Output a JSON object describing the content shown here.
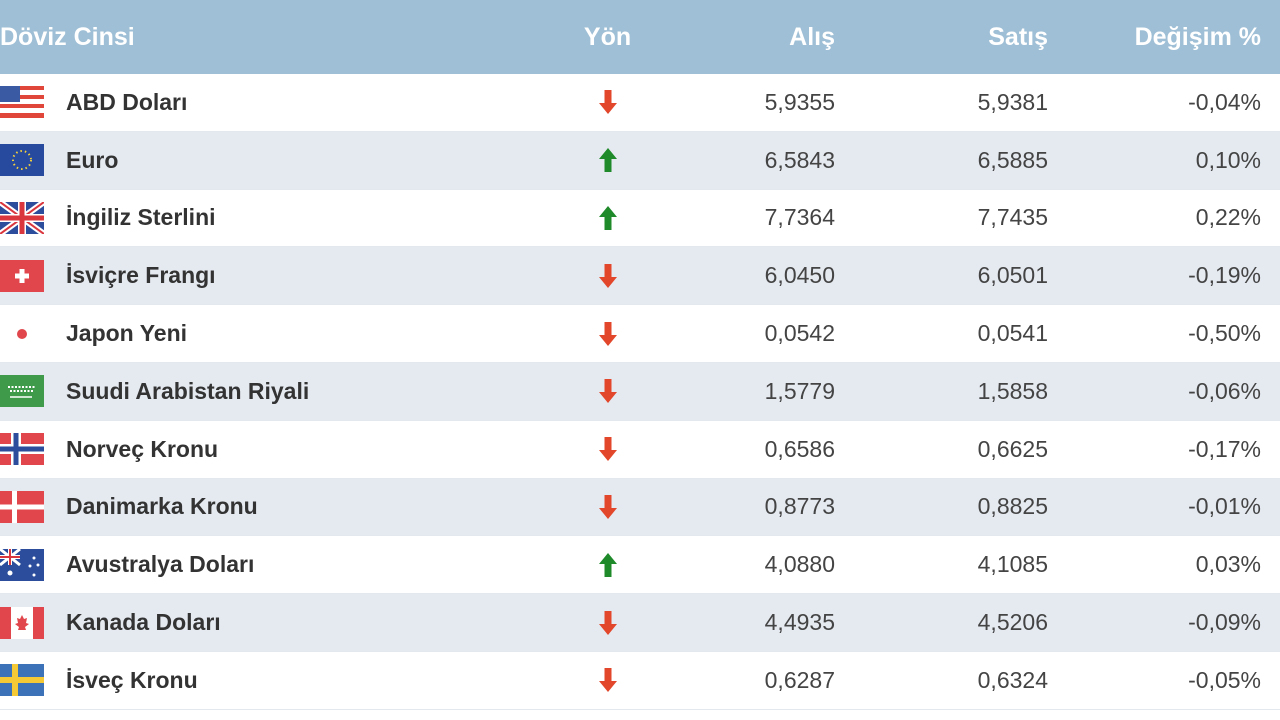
{
  "header": {
    "currency": "Döviz Cinsi",
    "direction": "Yön",
    "buy": "Alış",
    "sell": "Satış",
    "change": "Değişim %"
  },
  "colors": {
    "header_bg": "#9fbfd6",
    "up": "#1f8a2a",
    "down": "#e2472b"
  },
  "rows": [
    {
      "flag": "us-flag-icon",
      "name": "ABD Doları",
      "direction": "down",
      "buy": "5,9355",
      "sell": "5,9381",
      "change": "-0,04%"
    },
    {
      "flag": "eu-flag-icon",
      "name": "Euro",
      "direction": "up",
      "buy": "6,5843",
      "sell": "6,5885",
      "change": "0,10%"
    },
    {
      "flag": "uk-flag-icon",
      "name": "İngiliz Sterlini",
      "direction": "up",
      "buy": "7,7364",
      "sell": "7,7435",
      "change": "0,22%"
    },
    {
      "flag": "swiss-flag-icon",
      "name": "İsviçre Frangı",
      "direction": "down",
      "buy": "6,0450",
      "sell": "6,0501",
      "change": "-0,19%"
    },
    {
      "flag": "japan-flag-icon",
      "name": "Japon Yeni",
      "direction": "down",
      "buy": "0,0542",
      "sell": "0,0541",
      "change": "-0,50%"
    },
    {
      "flag": "saudi-flag-icon",
      "name": "Suudi Arabistan Riyali",
      "direction": "down",
      "buy": "1,5779",
      "sell": "1,5858",
      "change": "-0,06%"
    },
    {
      "flag": "norway-flag-icon",
      "name": "Norveç Kronu",
      "direction": "down",
      "buy": "0,6586",
      "sell": "0,6625",
      "change": "-0,17%"
    },
    {
      "flag": "denmark-flag-icon",
      "name": "Danimarka Kronu",
      "direction": "down",
      "buy": "0,8773",
      "sell": "0,8825",
      "change": "-0,01%"
    },
    {
      "flag": "australia-flag-icon",
      "name": "Avustralya Doları",
      "direction": "up",
      "buy": "4,0880",
      "sell": "4,1085",
      "change": "0,03%"
    },
    {
      "flag": "canada-flag-icon",
      "name": "Kanada Doları",
      "direction": "down",
      "buy": "4,4935",
      "sell": "4,5206",
      "change": "-0,09%"
    },
    {
      "flag": "sweden-flag-icon",
      "name": "İsveç Kronu",
      "direction": "down",
      "buy": "0,6287",
      "sell": "0,6324",
      "change": "-0,05%"
    }
  ]
}
